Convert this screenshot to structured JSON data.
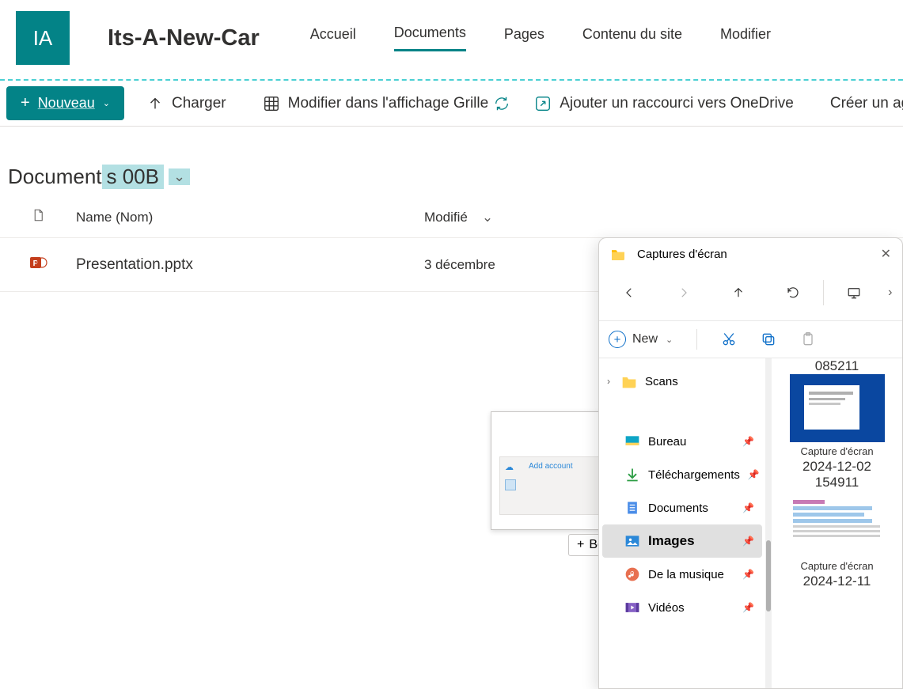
{
  "site": {
    "logo_text": "IA",
    "title": "Its-A-New-Car"
  },
  "nav": {
    "items": [
      {
        "label": "Accueil",
        "active": false
      },
      {
        "label": "Documents",
        "active": true
      },
      {
        "label": "Pages",
        "active": false
      },
      {
        "label": "Contenu du site",
        "active": false
      },
      {
        "label": "Modifier",
        "active": false
      }
    ]
  },
  "toolbar": {
    "new_label": "Nouveau",
    "upload_label": "Charger",
    "grid_label": "Modifier dans l'affichage Grille",
    "sync_label": "Sync",
    "onedrive_label": "Ajouter un raccourci vers OneDrive",
    "create_label": "Créer un age"
  },
  "library": {
    "title_prefix": "Document",
    "title_highlight": "s 00B",
    "columns": {
      "name": "Name (Nom)",
      "modified": "Modifié"
    },
    "rows": [
      {
        "name": "Presentation.pptx",
        "modified": "3 décembre",
        "type": "pptx"
      }
    ]
  },
  "drag": {
    "tooltip": "Bouton Copier",
    "ghost_text": "Add account"
  },
  "explorer": {
    "title": "Captures d'écran",
    "new_label": "New",
    "tree": {
      "scans": "Scans",
      "desktop": "Bureau",
      "downloads": "Téléchargements",
      "documents": "Documents",
      "pictures": "Images",
      "music": "De la musique",
      "videos": "Vidéos"
    },
    "thumbs": {
      "partial_top": "085211",
      "cap1_line1": "Capture d'écran",
      "cap1_line2": "2024-12-02",
      "cap1_line3": "154911",
      "cap2_line1": "Capture d'écran",
      "cap2_line2": "2024-12-11"
    }
  }
}
